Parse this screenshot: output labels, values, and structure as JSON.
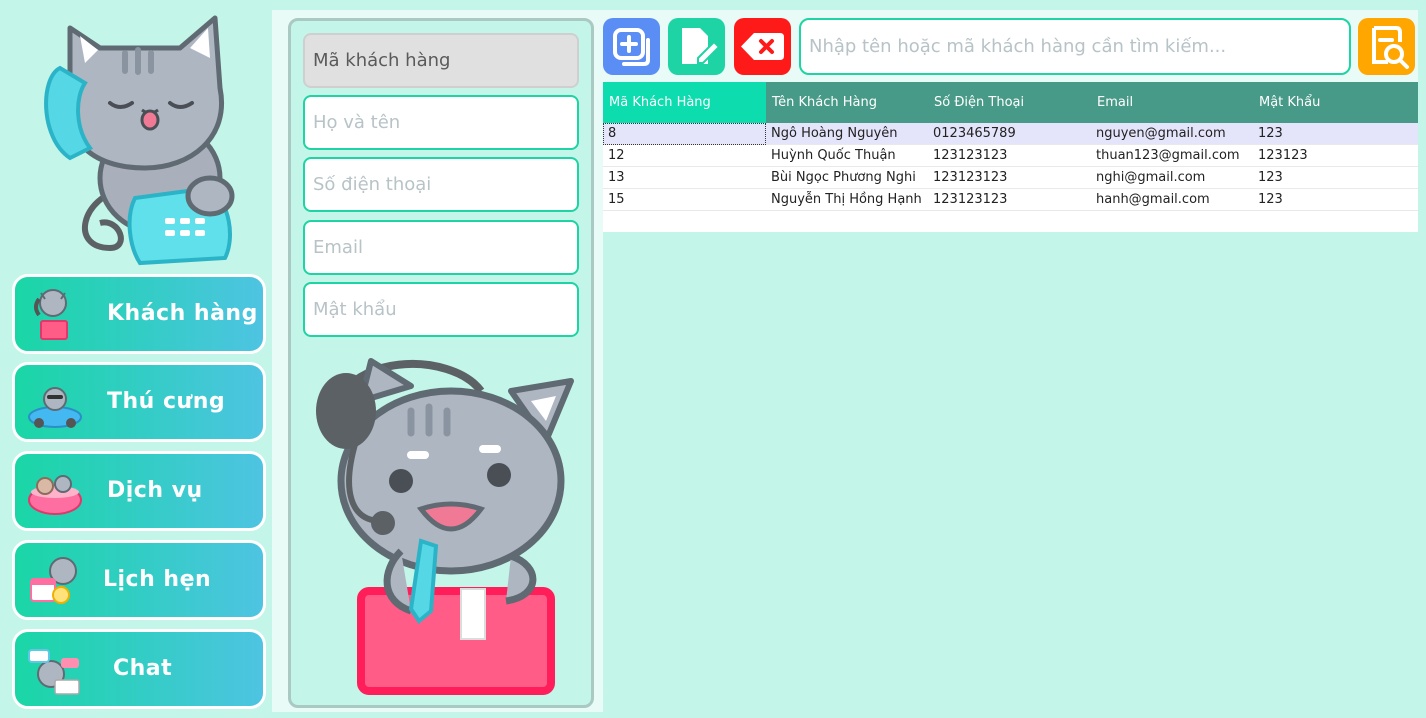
{
  "sidebar": {
    "items": [
      {
        "label": "Khách hàng",
        "icon": "cat-phone-icon"
      },
      {
        "label": "Thú cưng",
        "icon": "cat-car-icon"
      },
      {
        "label": "Dịch vụ",
        "icon": "cat-bath-icon"
      },
      {
        "label": "Lịch hẹn",
        "icon": "cat-calendar-icon"
      },
      {
        "label": "Chat",
        "icon": "cat-chat-icon"
      }
    ]
  },
  "form": {
    "ma_khach_hang_placeholder": "Mã khách hàng",
    "ho_ten_placeholder": "Họ và tên",
    "so_dien_thoai_placeholder": "Số điện thoại",
    "email_placeholder": "Email",
    "mat_khau_placeholder": "Mật khẩu"
  },
  "toolbar": {
    "search_placeholder": "Nhập tên hoặc mã khách hàng cần tìm kiếm...",
    "colors": {
      "add": "#5b8ef5",
      "edit": "#1ed3a4",
      "delete": "#ff1a1a",
      "search": "#ffa600"
    }
  },
  "table": {
    "headers": [
      "Mã Khách Hàng",
      "Tên Khách Hàng",
      "Số Điện Thoại",
      "Email",
      "Mật Khẩu"
    ],
    "rows": [
      [
        "8",
        "Ngô Hoàng Nguyên",
        "0123465789",
        "nguyen@gmail.com",
        "123"
      ],
      [
        "12",
        "Huỳnh Quốc Thuận",
        "123123123",
        "thuan123@gmail.com",
        "123123"
      ],
      [
        "13",
        "Bùi Ngọc Phương Nghi",
        "123123123",
        "nghi@gmail.com",
        "123"
      ],
      [
        "15",
        "Nguyễn Thị Hồng Hạnh",
        "123123123",
        "hanh@gmail.com",
        "123"
      ]
    ]
  }
}
